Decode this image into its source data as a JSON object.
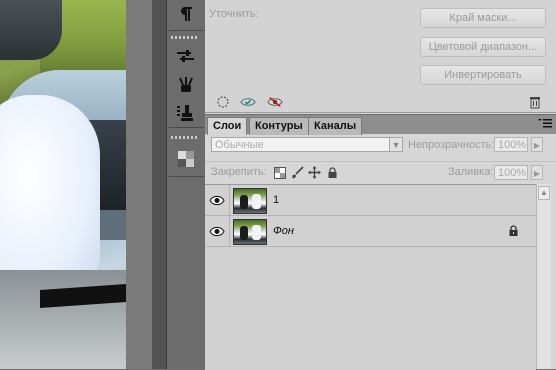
{
  "properties": {
    "refine_label": "Уточнить:",
    "buttons": [
      "Край маски...",
      "Цветовой диапазон...",
      "Инвертировать"
    ],
    "footer_icons": [
      "load-selection-icon",
      "apply-mask-icon",
      "disable-mask-icon",
      "delete-mask-icon"
    ]
  },
  "tabs": [
    {
      "label": "Слои",
      "active": true
    },
    {
      "label": "Контуры",
      "active": false
    },
    {
      "label": "Каналы",
      "active": false
    }
  ],
  "layers_panel": {
    "blend_mode": "Обычные",
    "opacity_label": "Непрозрачность:",
    "opacity_value": "100%",
    "lock_label": "Закрепить:",
    "fill_label": "Заливка:",
    "fill_value": "100%"
  },
  "layers": [
    {
      "name": "1",
      "visible": true,
      "locked": false,
      "italic": false
    },
    {
      "name": "Фон",
      "visible": true,
      "locked": true,
      "italic": true
    }
  ],
  "dock_icons": [
    "paragraph-icon",
    "adjustments-icon",
    "brush-presets-icon",
    "clone-source-icon",
    "swatches-icon"
  ]
}
